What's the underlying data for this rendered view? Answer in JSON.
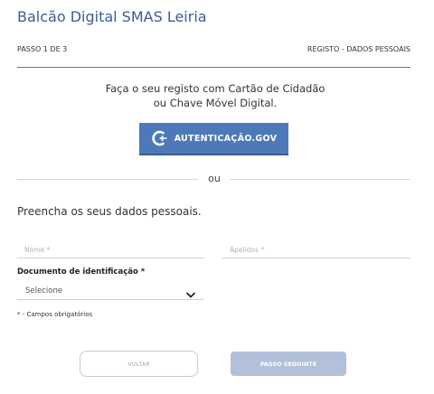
{
  "header": {
    "title": "Balcão Digital SMAS Leiria"
  },
  "steps": {
    "current": "PASSO 1 DE 3",
    "name": "REGISTO - DADOS PESSOAIS"
  },
  "intro": {
    "line1": "Faça o seu registo com Cartão de Cidadão",
    "line2": "ou Chave Móvel Digital."
  },
  "auth_button": {
    "label": "AUTENTICAÇÃO.GOV",
    "icon": "autenticacao-gov-logo-icon",
    "color": "#4d79b8"
  },
  "divider": {
    "text": "ou"
  },
  "form": {
    "prompt": "Preencha os seus dados pessoais.",
    "name_placeholder": "Nome *",
    "name_value": "",
    "surname_placeholder": "Apelidos *",
    "surname_value": "",
    "document_label": "Documento de identificação *",
    "document_selected": "Selecione",
    "required_note": "* - Campos obrigatórios"
  },
  "buttons": {
    "back": "VOLTAR",
    "next": "PASSO SEGUINTE",
    "next_color": "#b2c1d9"
  }
}
